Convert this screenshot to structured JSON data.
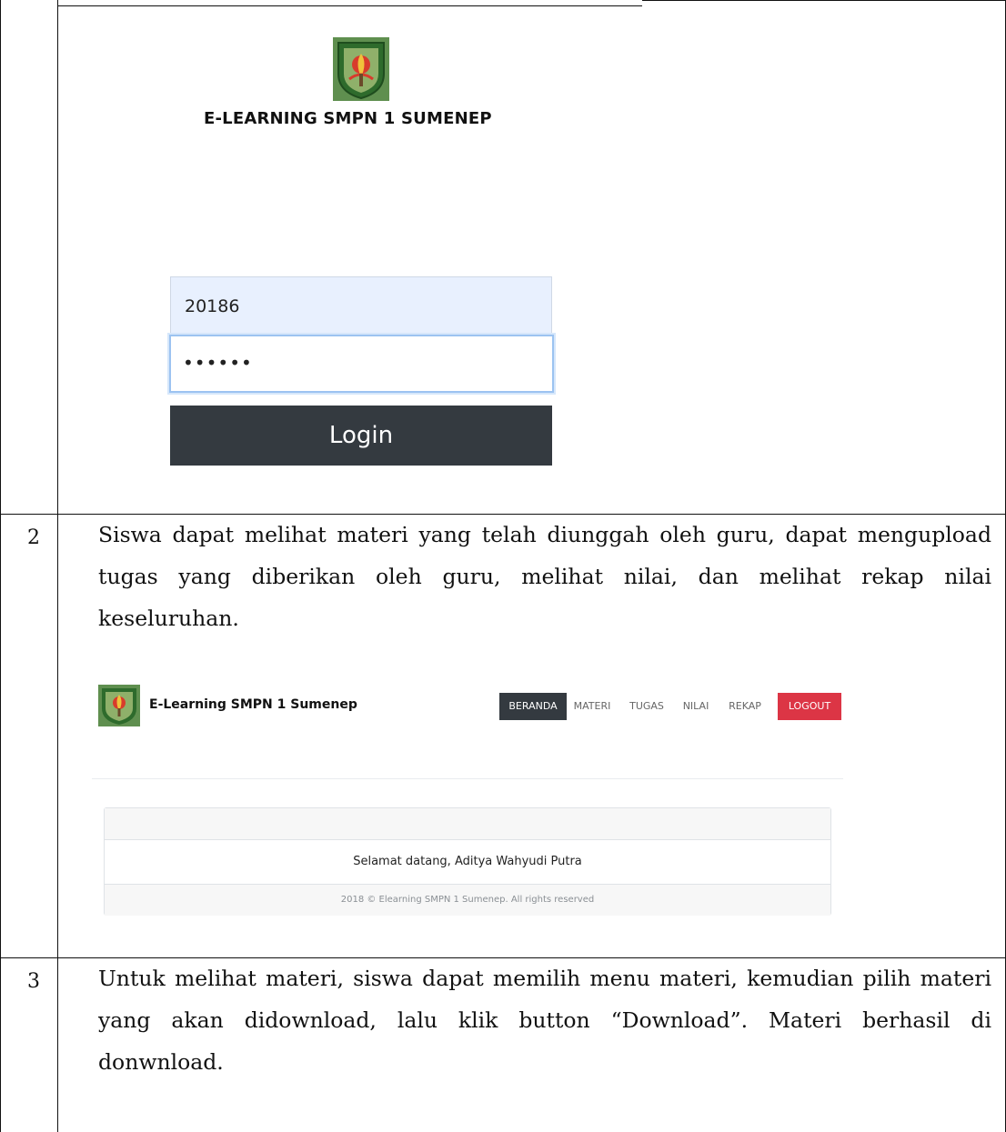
{
  "login": {
    "brand": "E-LEARNING SMPN 1 SUMENEP",
    "username_value": "20186",
    "password_value": "••••••",
    "login_label": "Login"
  },
  "rows": [
    {
      "number": "2",
      "text": "Siswa dapat melihat materi yang telah diunggah oleh guru, dapat mengupload tugas yang diberikan oleh guru, melihat nilai, dan melihat rekap nilai keseluruhan."
    },
    {
      "number": "3",
      "text": "Untuk melihat materi, siswa dapat memilih menu materi, kemudian pilih materi yang akan didownload, lalu klik button “Download”. Materi berhasil di donwnload."
    }
  ],
  "app": {
    "brand": "E-Learning SMPN 1 Sumenep",
    "nav": {
      "beranda": "BERANDA",
      "materi": "MATERI",
      "tugas": "TUGAS",
      "nilai": "NILAI",
      "rekap": "REKAP",
      "logout": "LOGOUT"
    },
    "welcome": "Selamat datang, Aditya Wahyudi Putra",
    "footer": "2018 © Elearning SMPN 1 Sumenep. All rights reserved"
  },
  "colors": {
    "dark_button": "#343a40",
    "logout_button": "#dc3545",
    "input_autofill": "#e8f0fe",
    "logo_green": "#3f7b3a"
  },
  "icons": [
    "school-logo-icon"
  ]
}
